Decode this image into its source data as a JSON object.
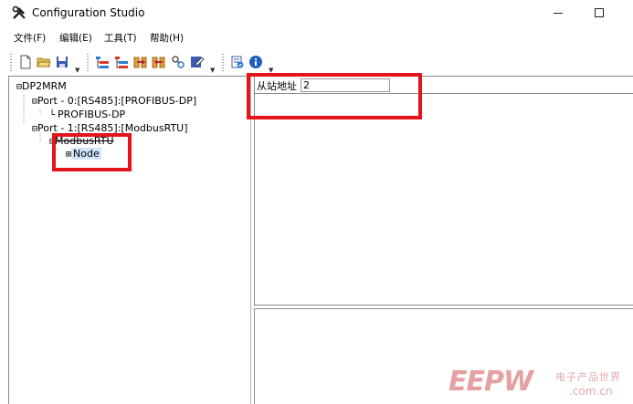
{
  "window": {
    "title": "Configuration Studio",
    "icon": "tools-icon"
  },
  "menubar": {
    "items": [
      {
        "label": "文件(F)"
      },
      {
        "label": "编辑(E)"
      },
      {
        "label": "工具(T)"
      },
      {
        "label": "帮助(H)"
      }
    ]
  },
  "toolbar": {
    "icons": [
      "new-file-icon",
      "open-folder-icon",
      "save-icon",
      "tree-add-icon",
      "tree-remove-icon",
      "upload-icon",
      "download-icon",
      "link-icon",
      "edit-icon",
      "config-check-icon",
      "info-icon"
    ]
  },
  "tree": {
    "root": "DP2MRM",
    "port0": "Port - 0:[RS485]:[PROFIBUS-DP]",
    "port0_child": "PROFIBUS-DP",
    "port1": "Port - 1:[RS485]:[ModbusRTU]",
    "port1_child": "ModbusRTU",
    "node": "Node",
    "expander_open": "⊟",
    "expander_closed": "⊞",
    "leaf_connector": "└"
  },
  "properties": {
    "slave_address_label": "从站地址",
    "slave_address_value": "2"
  },
  "watermark": {
    "logo": "EEPW",
    "tagline": "电子产品世界",
    "domain": ".com.cn"
  },
  "colors": {
    "highlight": "#e4141b",
    "selection": "#cfe4fb",
    "info": "#1f5fbf"
  }
}
